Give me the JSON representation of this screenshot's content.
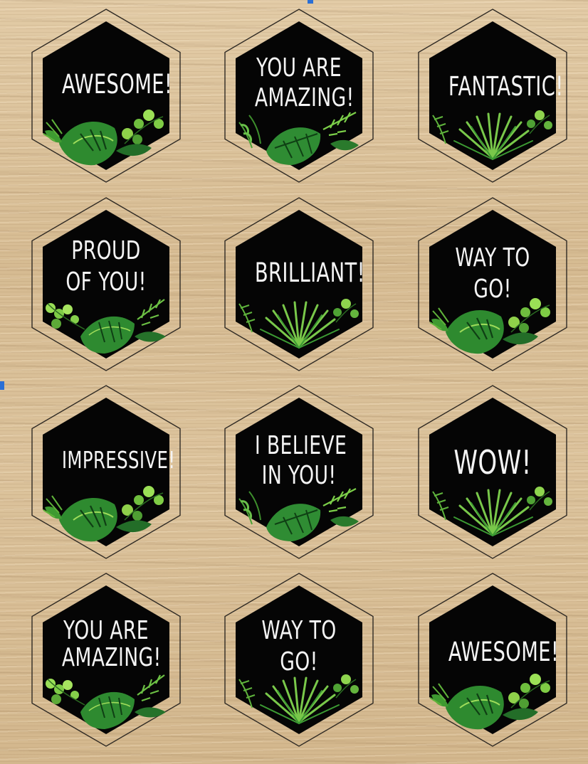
{
  "colors": {
    "hex_fill": "#050505",
    "hex_outline": "#2f2a24",
    "text": "#f4f4f4",
    "leaf_dark": "#1f7a2a",
    "leaf_light": "#7ec843",
    "wood": "#d9bf99"
  },
  "stickers": [
    {
      "lines": [
        "AWESOME!"
      ],
      "leaf_style": "monstera"
    },
    {
      "lines": [
        "YOU ARE",
        "AMAZING!"
      ],
      "leaf_style": "fern"
    },
    {
      "lines": [
        "FANTASTIC!"
      ],
      "leaf_style": "palm"
    },
    {
      "lines": [
        "PROUD",
        "OF YOU!"
      ],
      "leaf_style": "eucalyptus"
    },
    {
      "lines": [
        "BRILLIANT!"
      ],
      "leaf_style": "palm"
    },
    {
      "lines": [
        "WAY TO",
        "GO!"
      ],
      "leaf_style": "monstera"
    },
    {
      "lines": [
        "IMPRESSIVE!"
      ],
      "leaf_style": "monstera"
    },
    {
      "lines": [
        "I BELIEVE",
        "IN YOU!"
      ],
      "leaf_style": "fern"
    },
    {
      "lines": [
        "WOW!"
      ],
      "leaf_style": "palm"
    },
    {
      "lines": [
        "YOU ARE",
        "AMAZING!"
      ],
      "leaf_style": "eucalyptus"
    },
    {
      "lines": [
        "WAY TO",
        "GO!"
      ],
      "leaf_style": "palm"
    },
    {
      "lines": [
        "AWESOME!"
      ],
      "leaf_style": "monstera"
    }
  ]
}
